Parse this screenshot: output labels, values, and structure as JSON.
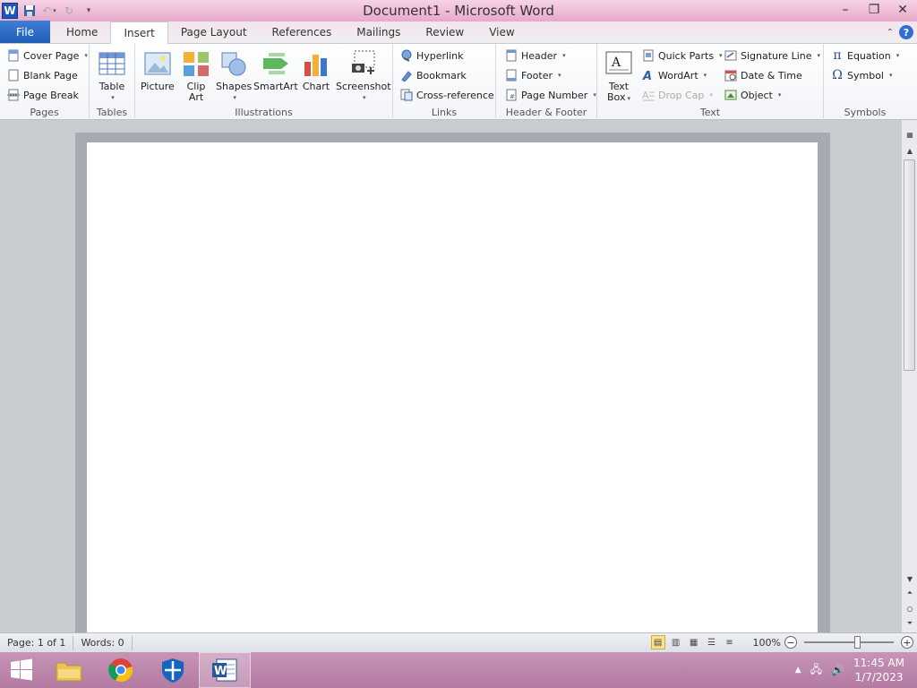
{
  "window": {
    "title": "Document1  -  Microsoft Word"
  },
  "tabs": [
    {
      "label": "File"
    },
    {
      "label": "Home"
    },
    {
      "label": "Insert"
    },
    {
      "label": "Page Layout"
    },
    {
      "label": "References"
    },
    {
      "label": "Mailings"
    },
    {
      "label": "Review"
    },
    {
      "label": "View"
    }
  ],
  "ribbon": {
    "pages": {
      "label": "Pages",
      "cover_page": "Cover Page",
      "blank_page": "Blank Page",
      "page_break": "Page Break"
    },
    "tables": {
      "label": "Tables",
      "table": "Table"
    },
    "illustrations": {
      "label": "Illustrations",
      "picture": "Picture",
      "clip_art": "Clip\nArt",
      "clip_art_1": "Clip",
      "clip_art_2": "Art",
      "shapes": "Shapes",
      "smartart": "SmartArt",
      "chart": "Chart",
      "screenshot": "Screenshot"
    },
    "links": {
      "label": "Links",
      "hyperlink": "Hyperlink",
      "bookmark": "Bookmark",
      "cross_reference": "Cross-reference"
    },
    "header_footer": {
      "label": "Header & Footer",
      "header": "Header",
      "footer": "Footer",
      "page_number": "Page Number"
    },
    "text": {
      "label": "Text",
      "text_box_1": "Text",
      "text_box_2": "Box",
      "quick_parts": "Quick Parts",
      "wordart": "WordArt",
      "drop_cap": "Drop Cap",
      "signature_line": "Signature Line",
      "date_time": "Date & Time",
      "object": "Object"
    },
    "symbols": {
      "label": "Symbols",
      "equation": "Equation",
      "symbol": "Symbol"
    }
  },
  "status": {
    "page": "Page: 1 of 1",
    "words": "Words: 0",
    "zoom": "100%"
  },
  "taskbar": {
    "time": "11:45 AM",
    "date": "1/7/2023"
  },
  "colors": {
    "title_bar": "#e7a9c9",
    "file_tab": "#1e5db5",
    "taskbar": "#b37aa2"
  }
}
